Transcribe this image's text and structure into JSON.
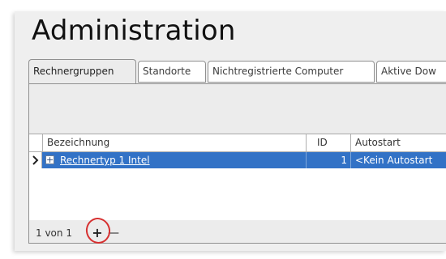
{
  "page": {
    "title": "Administration"
  },
  "tabs": [
    {
      "label": "Rechnergruppen",
      "active": true
    },
    {
      "label": "Standorte"
    },
    {
      "label": "Nichtregistrierte Computer"
    },
    {
      "label": "Aktive Dow"
    }
  ],
  "grid": {
    "columns": {
      "name": "Bezeichnung",
      "id": "ID",
      "autostart": "Autostart"
    },
    "rows": [
      {
        "name": "Rechnertyp 1 Intel",
        "id": "1",
        "autostart": "<Kein Autostart"
      }
    ]
  },
  "pager": {
    "text": "1 von 1",
    "add": "+",
    "remove": "—"
  },
  "colors": {
    "selection": "#3272c6",
    "highlight_circle": "#d63030"
  }
}
